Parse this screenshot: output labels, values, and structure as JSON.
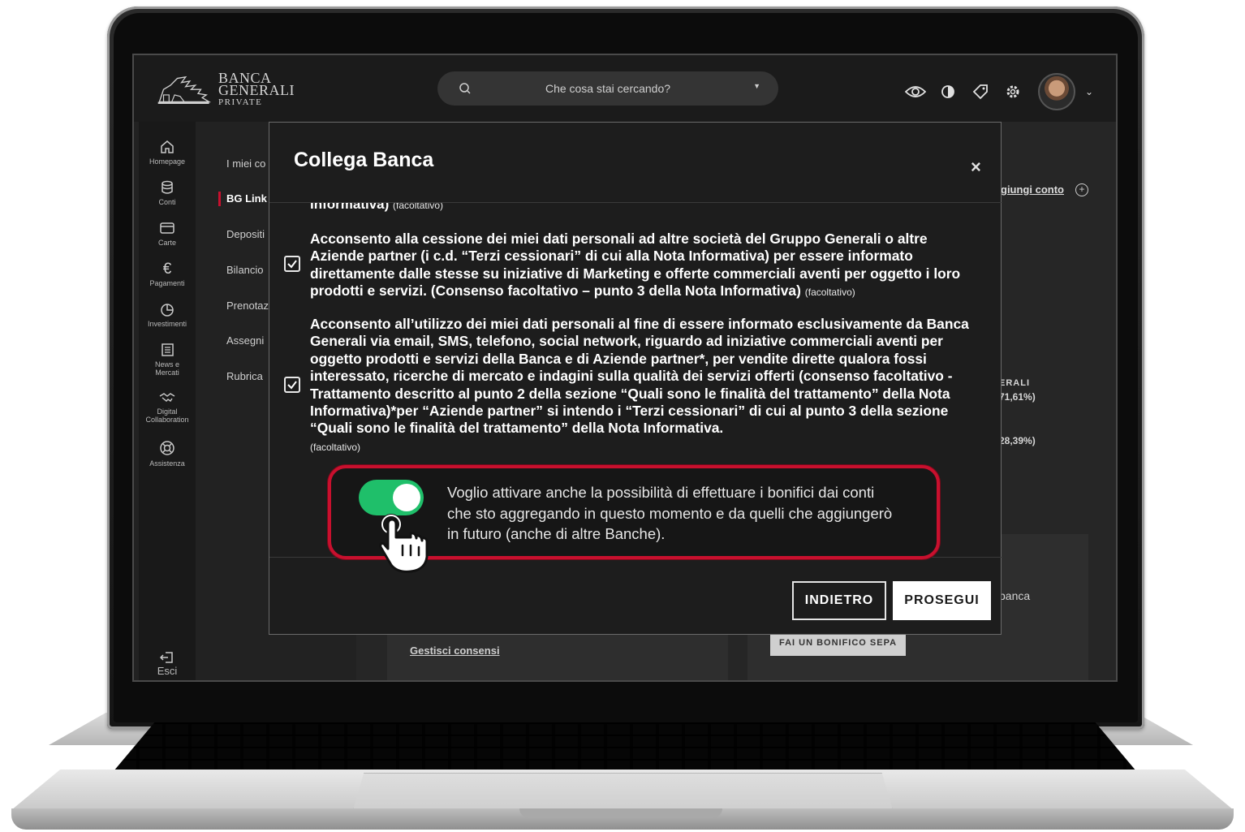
{
  "header": {
    "logo_line1": "BANCA",
    "logo_line2": "GENERALI",
    "logo_line3": "PRIVATE",
    "search_placeholder": "Che cosa stai cercando?",
    "icons": [
      "eye-icon",
      "contrast-icon",
      "tag-icon",
      "gear-icon",
      "avatar",
      "chevron-down-icon"
    ]
  },
  "sidebar": {
    "items": [
      {
        "label": "Homepage",
        "icon": "home-icon"
      },
      {
        "label": "Conti",
        "icon": "database-icon"
      },
      {
        "label": "Carte",
        "icon": "card-icon"
      },
      {
        "label": "Pagamenti",
        "icon": "euro-icon"
      },
      {
        "label": "Investimenti",
        "icon": "pie-icon"
      },
      {
        "label": "News e",
        "label2": "Mercati",
        "icon": "news-icon"
      },
      {
        "label": "Digital",
        "label2": "Collaboration",
        "icon": "handshake-icon"
      },
      {
        "label": "Assistenza",
        "icon": "lifebuoy-icon"
      }
    ],
    "logout": {
      "label": "Esci",
      "icon": "logout-icon"
    }
  },
  "submenu": {
    "items": [
      "I miei co",
      "BG Link",
      "Depositi",
      "Bilancio",
      "Prenotaz",
      "Assegni",
      "Rubrica"
    ]
  },
  "background": {
    "add_account": "giungi conto",
    "erali": "ERALI",
    "pct1": "71,61%)",
    "pct2": "28,39%)",
    "banca": "banca",
    "manage_consents": "Gestisci consensi",
    "sepa_button": "FAI UN BONIFICO SEPA"
  },
  "modal": {
    "title": "Collega Banca",
    "close": "×",
    "cut_text": "Informativa)",
    "cut_optional": "(facoltativo)",
    "consent1": "Acconsento alla cessione dei miei dati personali ad altre società del Gruppo Generali o altre Aziende partner (i c.d. “Terzi cessionari” di cui alla Nota Informativa) per essere informato direttamente dalle stesse su iniziative di Marketing e offerte commerciali aventi per oggetto i loro prodotti e servizi. (Consenso facoltativo – punto 3 della Nota Informativa)",
    "consent1_optional": "(facoltativo)",
    "consent1_checked": true,
    "consent2": "Acconsento all’utilizzo dei miei dati personali al fine di essere informato esclusivamente da Banca Generali via email, SMS, telefono, social network, riguardo ad iniziative commerciali aventi per oggetto prodotti e servizi della Banca e di Aziende partner*, per vendite dirette qualora fossi interessato, ricerche di mercato e indagini sulla qualità dei servizi offerti (consenso facoltativo - Trattamento descritto al punto 2 della sezione “Quali sono le finalità del trattamento” della Nota Informativa)*per “Aziende partner” si intendo i “Terzi cessionari” di cui al punto 3 della sezione “Quali sono le finalità del trattamento” della Nota Informativa.",
    "consent2_optional": "(facoltativo)",
    "consent2_checked": true,
    "toggle_on": true,
    "toggle_text": "Voglio attivare anche la possibilità di effettuare i bonifici dai conti che sto aggregando in questo momento e da quelli che aggiungerò in futuro (anche di altre Banche).",
    "back_button": "INDIETRO",
    "next_button": "PROSEGUI"
  },
  "colors": {
    "accent_red": "#c8102e",
    "toggle_green": "#1fbf6a",
    "modal_bg": "#1d1d1d"
  }
}
